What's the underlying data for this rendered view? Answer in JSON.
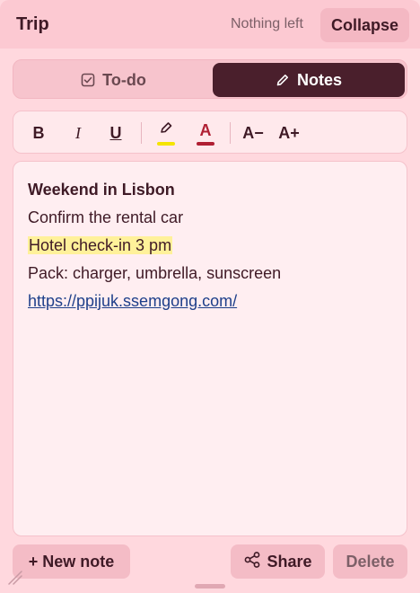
{
  "header": {
    "title": "Trip",
    "status": "Nothing left",
    "collapse_label": "Collapse"
  },
  "tabs": [
    {
      "label": "To-do",
      "icon": "checkbox-icon",
      "active": false
    },
    {
      "label": "Notes",
      "icon": "pencil-icon",
      "active": true
    }
  ],
  "toolbar": {
    "bold": "B",
    "italic": "I",
    "underline": "U",
    "highlight_icon": "highlighter-icon",
    "font_color_label": "A",
    "font_smaller": "A−",
    "font_bigger": "A+",
    "highlight_color": "#f5e400",
    "font_color": "#b01f33"
  },
  "note": {
    "heading": "Weekend in Lisbon",
    "line1": "Confirm the rental car",
    "line2": "Hotel check-in 3 pm",
    "line3": "Pack: charger, umbrella, sunscreen",
    "link": "https://ppijuk.ssemgong.com/"
  },
  "footer": {
    "new_note_label": "+ New note",
    "share_label": "Share",
    "delete_label": "Delete"
  },
  "colors": {
    "accent": "#4a1f2c",
    "background": "#ffd8de",
    "highlight": "#fff19a",
    "link": "#1e3f8a"
  }
}
